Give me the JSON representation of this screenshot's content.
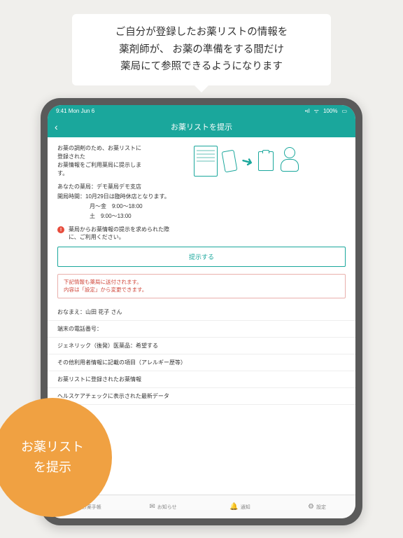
{
  "promo": {
    "line1": "ご自分が登録したお薬リストの情報を",
    "line2": "薬剤師が、 お薬の準備をする間だけ",
    "line3": "薬局にて参照できるようになります"
  },
  "statusbar": {
    "time": "9:41  Mon Jun 6",
    "wifi": "wifi-icon",
    "battery": "100%",
    "signal": "signal-icon"
  },
  "nav": {
    "title": "お薬リストを提示",
    "back": "‹"
  },
  "intro": {
    "line1": "お薬の調剤のため、お薬リストに登録された",
    "line2": "お薬情報をご利用薬局に提示します。"
  },
  "pharmacy": {
    "label": "あなたの薬局：",
    "name": "デモ薬局デモ支店"
  },
  "hours": {
    "label": "開局時間：",
    "line1": "10月29日は臨時休店となります。",
    "line2": "月〜金　9:00〜18:00",
    "line3": "土　9:00〜13:00"
  },
  "alert": {
    "line1": "薬局からお薬情報の提示を求められた際",
    "line2": "に、ご利用ください。"
  },
  "submit_label": "提示する",
  "red_note": {
    "line1": "下記情報も薬局に送付されます。",
    "line2": "内容は「設定」から変更できます。"
  },
  "rows": [
    "おなまえ：山田 花子 さん",
    "端末の電話番号：",
    "ジェネリック（後発）医薬品：希望する",
    "その他利用者情報に記載の項目（アレルギー歴等）",
    "お薬リストに登録されたお薬情報",
    "ヘルスケアチェックに表示された最新データ"
  ],
  "tabs": [
    {
      "icon": "📖",
      "label": "お薬手帳"
    },
    {
      "icon": "✉",
      "label": "お知らせ"
    },
    {
      "icon": "🔔",
      "label": "通知"
    },
    {
      "icon": "⚙",
      "label": "設定"
    }
  ],
  "badge": {
    "line1": "お薬リスト",
    "line2": "を提示"
  }
}
